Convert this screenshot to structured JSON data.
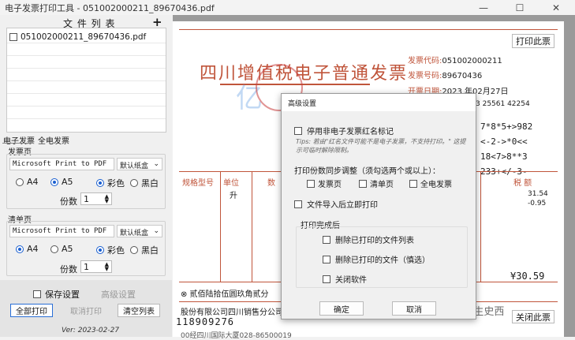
{
  "window": {
    "title": "电子发票打印工具 - 051002000211_89670436.pdf"
  },
  "left": {
    "file_list_title": "文 件 列 表",
    "add_symbol": "+",
    "files": [
      "051002000211_89670436.pdf"
    ],
    "tabs": [
      "电子发票",
      "全电发票"
    ],
    "invoice_page": {
      "label": "发票页",
      "printer": "Microsoft Print to PDF",
      "tray": "默认纸盒",
      "sizes": [
        "A4",
        "A5"
      ],
      "selected_size": "A5",
      "colors": [
        "彩色",
        "黑白"
      ],
      "selected_color": "彩色",
      "copies_label": "份数",
      "copies": "1"
    },
    "list_page": {
      "label": "清单页",
      "printer": "Microsoft Print to PDF",
      "tray": "默认纸盒",
      "sizes": [
        "A4",
        "A5"
      ],
      "selected_size": "A4",
      "colors": [
        "彩色",
        "黑白"
      ],
      "selected_color": "彩色",
      "copies_label": "份数",
      "copies": "1"
    },
    "save_settings": "保存设置",
    "advanced_settings": "高级设置",
    "print_all": "全部打印",
    "cancel_print": "取消打印",
    "clear_list": "清空列表",
    "version": "Ver: 2023-02-27"
  },
  "viewer": {
    "print_button": "打印此票",
    "invoice_title": "四川增值税电子普通发票",
    "watermark": "亿",
    "code_label": "发票代码:",
    "code": "051002000211",
    "number_label": "发票号码:",
    "number": "89670436",
    "date_label": "开票日期:",
    "date": "2023 年02月27日",
    "check_code_partial": "3 25561 42254",
    "cipher_lines": [
      "7*8*5+>982",
      "<-2->*0<<",
      "18<7>8**3",
      "233+</-3-"
    ],
    "col_model": "规格型号",
    "col_unit": "单位",
    "col_unit2": "升",
    "col_qty": "数",
    "col_tax": "税  额",
    "tax_values": [
      "31.54",
      "-0.95"
    ],
    "total": "¥30.59",
    "amount_words": "⊗ 贰佰陆拾伍圆玖角贰分",
    "seller": "股份有限公司四川销售分公司",
    "seller_id": "118909276",
    "seller_addr": "00经四川国际大厦028-86500019",
    "close_button": "关闭此票",
    "brand_overlay": "公众号 · 辣香生史西"
  },
  "dialog": {
    "title": "高级设置",
    "disable_red": "停用非电子发票红名标记",
    "tips": "Tips: 若由\"红名文件可能不是电子发票，不支持打印。\" 这提示可临时解除限制。",
    "sync_label": "打印份数同步调整（须勾选两个或以上）：",
    "sync_options": [
      "发票页",
      "清单页",
      "全电发票"
    ],
    "print_after_import": "文件导入后立即打印",
    "after_print_title": "打印完成后",
    "after_print_options": [
      "删除已打印的文件列表",
      "删除已打印的文件（慎选）",
      "关闭软件"
    ],
    "ok": "确定",
    "cancel": "取消"
  }
}
